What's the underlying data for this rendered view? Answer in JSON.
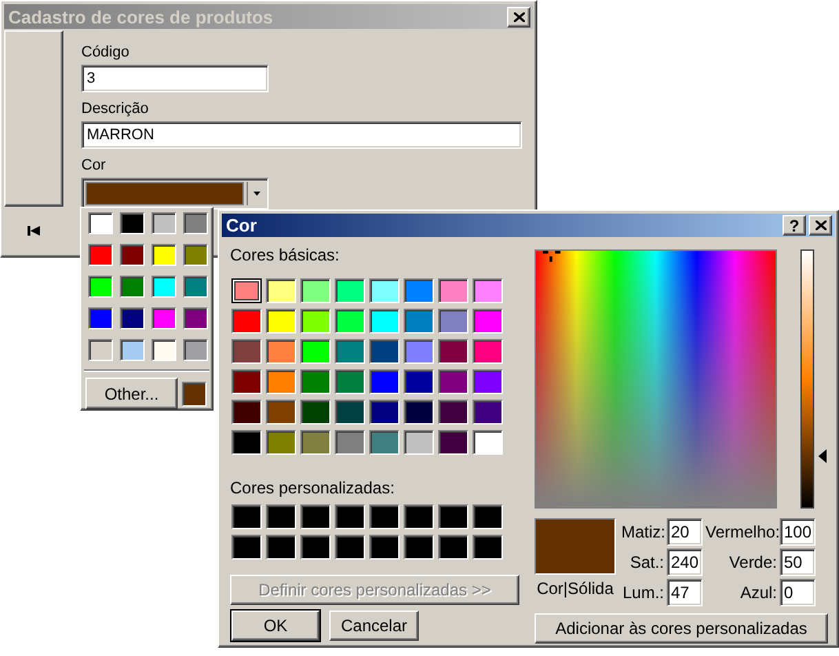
{
  "main_window": {
    "title": "Cadastro de cores de produtos",
    "active": false,
    "fields": [
      {
        "label": "Código",
        "value": "3",
        "kind": "short"
      },
      {
        "label": "Descrição",
        "value": "MARRON",
        "kind": "long"
      }
    ],
    "color_field": {
      "label": "Cor",
      "color": "#643200"
    }
  },
  "color_popup": {
    "swatches": [
      {
        "color": "#ffffff"
      },
      {
        "color": "#000000"
      },
      {
        "color": "#c0c0c0"
      },
      {
        "color": "#808080"
      },
      {
        "color": "#ff0000"
      },
      {
        "color": "#800000"
      },
      {
        "color": "#ffff00"
      },
      {
        "color": "#808000"
      },
      {
        "color": "#00ff00"
      },
      {
        "color": "#008000"
      },
      {
        "color": "#00ffff"
      },
      {
        "color": "#008080"
      },
      {
        "color": "#0000ff"
      },
      {
        "color": "#000080"
      },
      {
        "color": "#ff00ff"
      },
      {
        "color": "#800080"
      },
      {
        "color": "#d4d0c8"
      },
      {
        "color": "#a6caf0"
      },
      {
        "color": "#fffbf0"
      },
      {
        "color": "#a0a0a4"
      }
    ],
    "other_button": "Other...",
    "current": {
      "color": "#643200"
    }
  },
  "color_dialog": {
    "title": "Cor",
    "active": true,
    "help_button": "?",
    "basic_label": "Cores básicas:",
    "basic_colors": [
      {
        "color": "#ff8080",
        "selected": true
      },
      {
        "color": "#ffff80",
        "selected": false
      },
      {
        "color": "#80ff80",
        "selected": false
      },
      {
        "color": "#00ff80",
        "selected": false
      },
      {
        "color": "#80ffff",
        "selected": false
      },
      {
        "color": "#0080ff",
        "selected": false
      },
      {
        "color": "#ff80c0",
        "selected": false
      },
      {
        "color": "#ff80ff",
        "selected": false
      },
      {
        "color": "#ff0000",
        "selected": false
      },
      {
        "color": "#ffff00",
        "selected": false
      },
      {
        "color": "#80ff00",
        "selected": false
      },
      {
        "color": "#00ff40",
        "selected": false
      },
      {
        "color": "#00ffff",
        "selected": false
      },
      {
        "color": "#0080c0",
        "selected": false
      },
      {
        "color": "#8080c0",
        "selected": false
      },
      {
        "color": "#ff00ff",
        "selected": false
      },
      {
        "color": "#804040",
        "selected": false
      },
      {
        "color": "#ff8040",
        "selected": false
      },
      {
        "color": "#00ff00",
        "selected": false
      },
      {
        "color": "#008080",
        "selected": false
      },
      {
        "color": "#004080",
        "selected": false
      },
      {
        "color": "#8080ff",
        "selected": false
      },
      {
        "color": "#800040",
        "selected": false
      },
      {
        "color": "#ff0080",
        "selected": false
      },
      {
        "color": "#800000",
        "selected": false
      },
      {
        "color": "#ff8000",
        "selected": false
      },
      {
        "color": "#008000",
        "selected": false
      },
      {
        "color": "#008040",
        "selected": false
      },
      {
        "color": "#0000ff",
        "selected": false
      },
      {
        "color": "#0000a0",
        "selected": false
      },
      {
        "color": "#800080",
        "selected": false
      },
      {
        "color": "#8000ff",
        "selected": false
      },
      {
        "color": "#400000",
        "selected": false
      },
      {
        "color": "#804000",
        "selected": false
      },
      {
        "color": "#004000",
        "selected": false
      },
      {
        "color": "#004040",
        "selected": false
      },
      {
        "color": "#000080",
        "selected": false
      },
      {
        "color": "#000040",
        "selected": false
      },
      {
        "color": "#400040",
        "selected": false
      },
      {
        "color": "#400080",
        "selected": false
      },
      {
        "color": "#000000",
        "selected": false
      },
      {
        "color": "#808000",
        "selected": false
      },
      {
        "color": "#808040",
        "selected": false
      },
      {
        "color": "#808080",
        "selected": false
      },
      {
        "color": "#408080",
        "selected": false
      },
      {
        "color": "#c0c0c0",
        "selected": false
      },
      {
        "color": "#400040",
        "selected": false
      },
      {
        "color": "#ffffff",
        "selected": false
      }
    ],
    "custom_label": "Cores personalizadas:",
    "custom_colors": [
      {
        "color": "#000000"
      },
      {
        "color": "#000000"
      },
      {
        "color": "#000000"
      },
      {
        "color": "#000000"
      },
      {
        "color": "#000000"
      },
      {
        "color": "#000000"
      },
      {
        "color": "#000000"
      },
      {
        "color": "#000000"
      },
      {
        "color": "#000000"
      },
      {
        "color": "#000000"
      },
      {
        "color": "#000000"
      },
      {
        "color": "#000000"
      },
      {
        "color": "#000000"
      },
      {
        "color": "#000000"
      },
      {
        "color": "#000000"
      },
      {
        "color": "#000000"
      }
    ],
    "define_button": {
      "label": "Definir cores personalizadas >>",
      "disabled": true
    },
    "ok_button": "OK",
    "cancel_button": "Cancelar",
    "luminance": {
      "level": 0.2
    },
    "solid_color": {
      "color": "#643200",
      "label": "Cor|Sólida"
    },
    "values": [
      {
        "label": "Matiz:",
        "value": "20"
      },
      {
        "label": "Vermelho:",
        "value": "100"
      },
      {
        "label": "Sat.:",
        "value": "240"
      },
      {
        "label": "Verde:",
        "value": "50"
      },
      {
        "label": "Lum.:",
        "value": "47"
      },
      {
        "label": "Azul:",
        "value": "0"
      }
    ],
    "add_button": "Adicionar às cores personalizadas"
  }
}
